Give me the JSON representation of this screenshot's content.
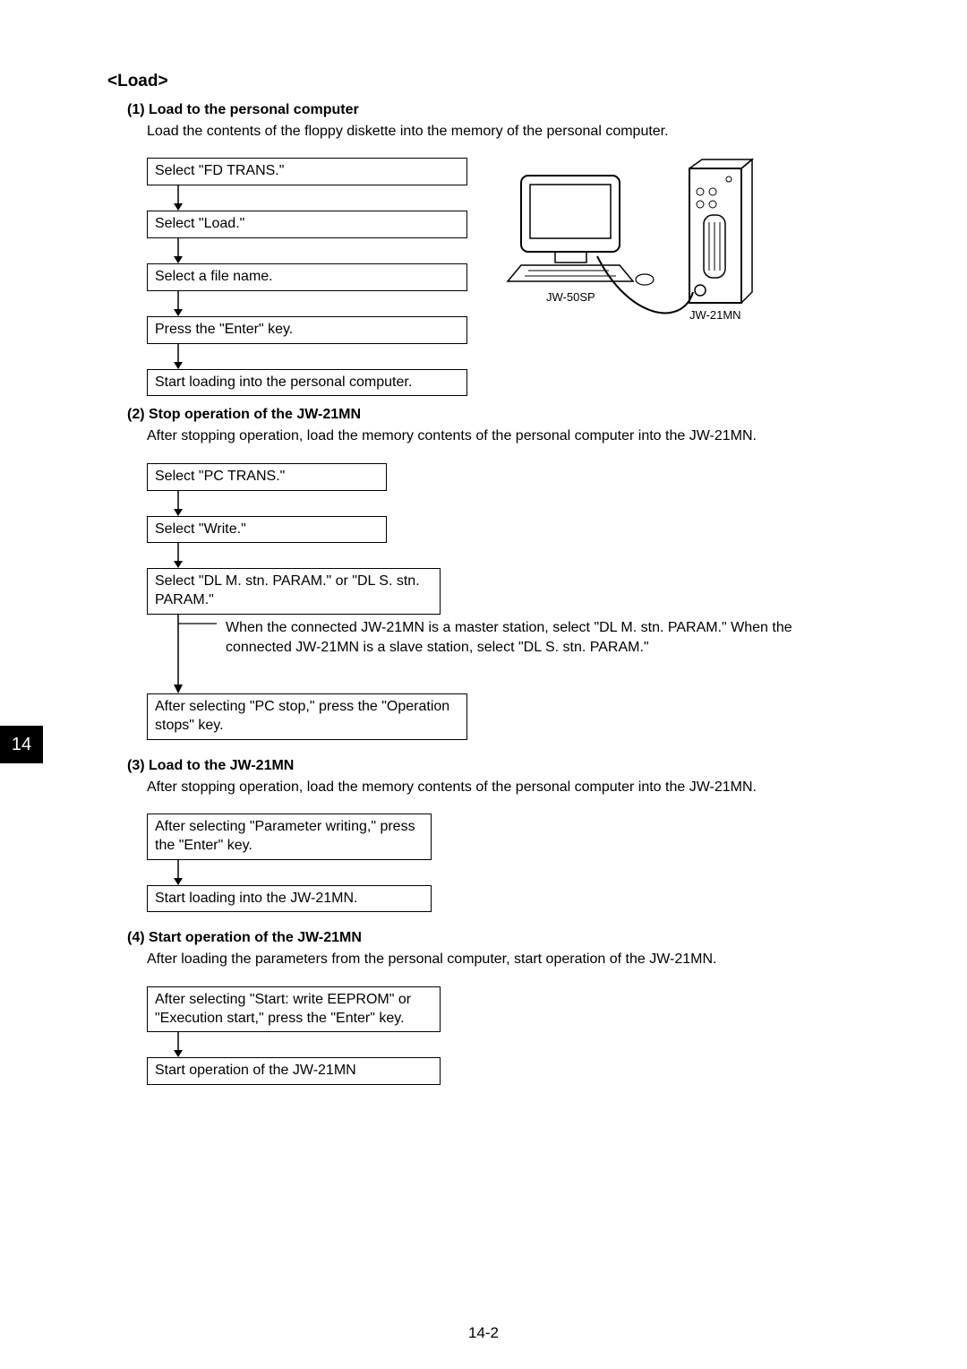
{
  "page_tab": "14",
  "page_number": "14-2",
  "section_title": "<Load>",
  "sub1": {
    "title": "(1) Load to the personal computer",
    "desc": "Load the contents of the floppy diskette into the memory of the personal computer.",
    "steps": [
      "Select \"FD TRANS.\"",
      "Select \"Load.\"",
      "Select a file name.",
      "Press the \"Enter\" key.",
      "Start loading into the personal computer."
    ]
  },
  "sub2": {
    "title": "(2) Stop operation of the JW-21MN",
    "desc": "After stopping operation, load the memory contents of the personal computer into the JW-21MN.",
    "steps": [
      "Select \"PC TRANS.\"",
      "Select \"Write.\"",
      "Select \"DL M. stn. PARAM.\" or \"DL S. stn. PARAM.\"",
      "After selecting \"PC stop,\" press the \"Operation stops\" key."
    ],
    "sidenote": "When the connected JW-21MN is a master station, select \"DL M. stn. PARAM.\" When the connected JW-21MN is a slave station, select \"DL S. stn. PARAM.\""
  },
  "sub3": {
    "title": "(3) Load to the JW-21MN",
    "desc": "After stopping operation, load the memory contents of the personal computer into the JW-21MN.",
    "steps": [
      "After selecting \"Parameter writing,\" press the \"Enter\" key.",
      "Start loading into the JW-21MN."
    ]
  },
  "sub4": {
    "title": "(4) Start operation of the JW-21MN",
    "desc": "After loading the parameters from the personal computer, start operation of the JW-21MN.",
    "steps": [
      "After selecting \"Start: write EEPROM\" or \"Execution start,\" press the \"Enter\" key.",
      "Start operation of the JW-21MN"
    ]
  },
  "illus": {
    "pc_label": "JW-50SP",
    "module_label": "JW-21MN"
  }
}
